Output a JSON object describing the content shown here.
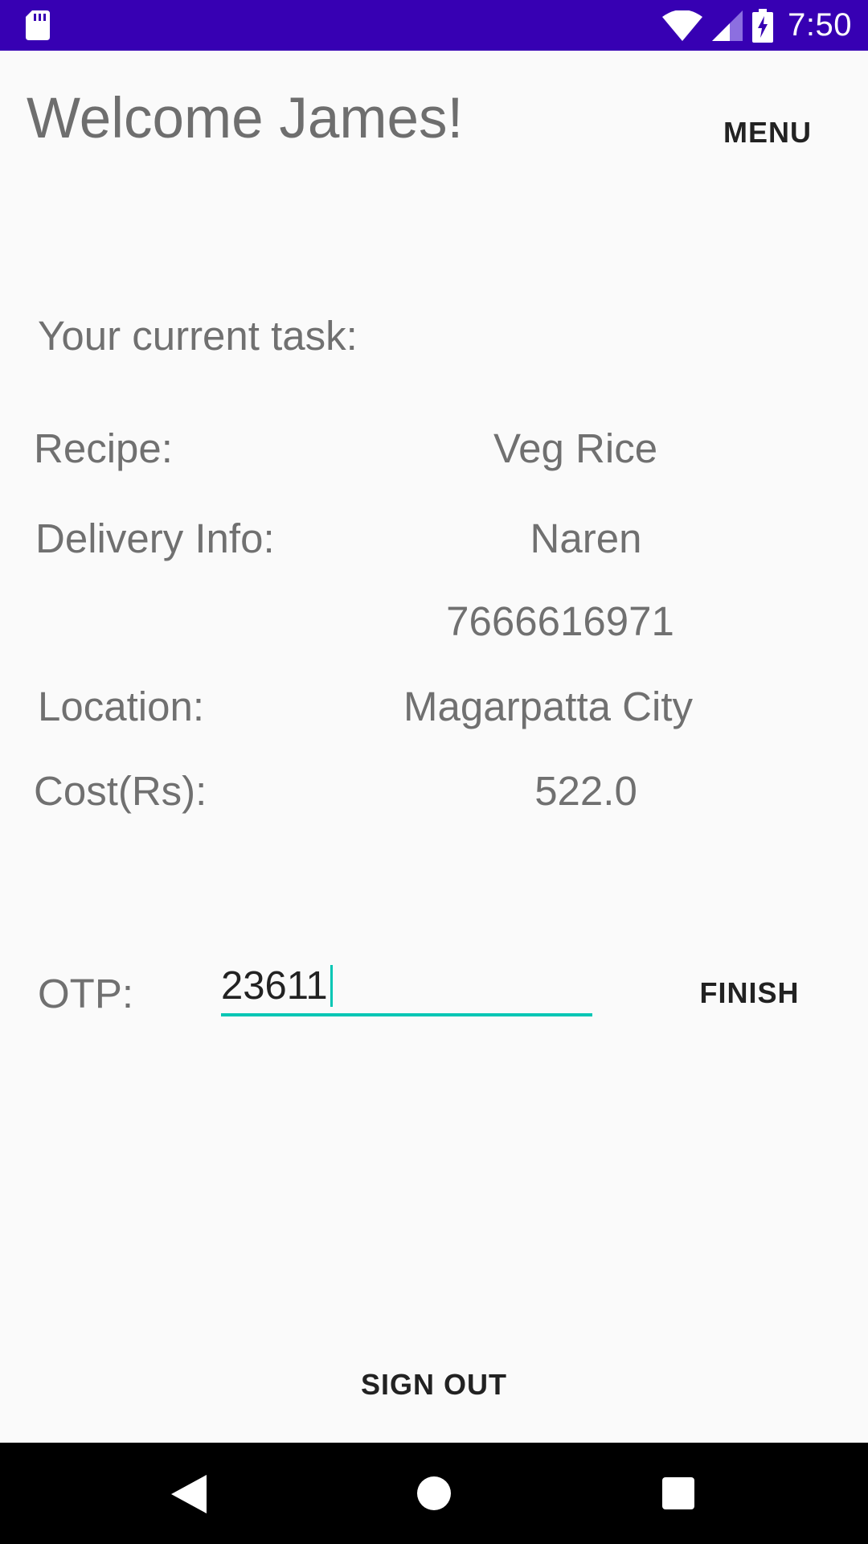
{
  "status_bar": {
    "time": "7:50",
    "icons": [
      "sd-card-icon",
      "wifi-icon",
      "signal-icon",
      "battery-charging-icon"
    ],
    "background": "#3700b3"
  },
  "header": {
    "welcome": "Welcome James!",
    "menu_label": "MENU"
  },
  "task": {
    "heading": "Your current task:",
    "recipe_label": "Recipe:",
    "recipe_value": "Veg Rice",
    "delivery_label": "Delivery Info:",
    "delivery_name": "Naren",
    "delivery_phone": "7666616971",
    "location_label": "Location:",
    "location_value": "Magarpatta City",
    "cost_label": "Cost(Rs):",
    "cost_value": "522.0"
  },
  "otp": {
    "label": "OTP:",
    "value": "23611",
    "finish_label": "FINISH",
    "accent": "#00c6b4"
  },
  "footer": {
    "sign_out_label": "SIGN OUT"
  },
  "nav_bar": {
    "icons": [
      "back-icon",
      "home-icon",
      "recents-icon"
    ]
  }
}
